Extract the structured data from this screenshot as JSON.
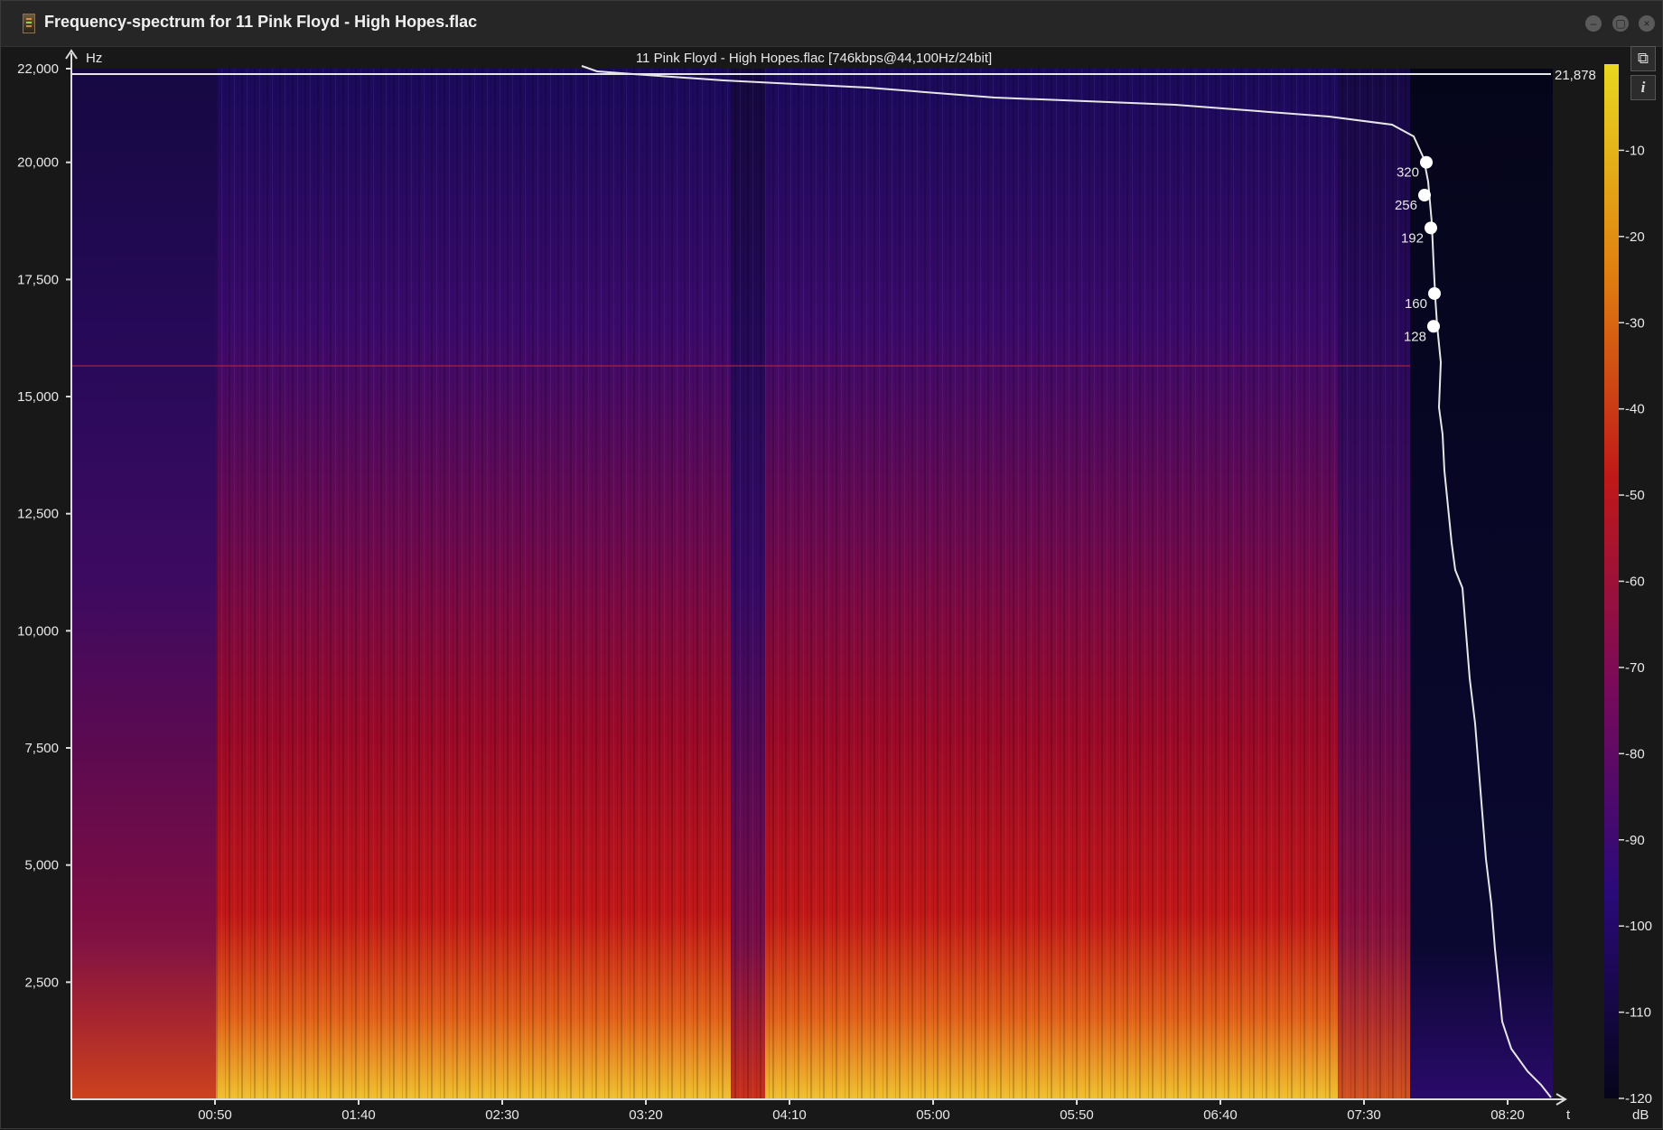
{
  "window": {
    "title": "Frequency-spectrum for 11 Pink Floyd - High Hopes.flac",
    "minimize_glyph": "–",
    "maximize_glyph": "▢",
    "close_glyph": "×"
  },
  "plot": {
    "file_info": "11 Pink Floyd - High Hopes.flac [746kbps@44,100Hz/24bit]",
    "y_unit": "Hz",
    "x_unit": "t",
    "y_ticks": [
      "22,000",
      "20,000",
      "17,500",
      "15,000",
      "12,500",
      "10,000",
      "7,500",
      "5,000",
      "2,500"
    ],
    "x_ticks": [
      "00:50",
      "01:40",
      "02:30",
      "03:20",
      "04:10",
      "05:00",
      "05:50",
      "06:40",
      "07:30",
      "08:20"
    ],
    "cutoff_label": "21,878",
    "bitrate_markers": [
      {
        "label": "320",
        "freq": 20000
      },
      {
        "label": "256",
        "freq": 19300
      },
      {
        "label": "192",
        "freq": 18600
      },
      {
        "label": "160",
        "freq": 17200
      },
      {
        "label": "128",
        "freq": 16500
      }
    ]
  },
  "colorbar": {
    "unit": "dB",
    "ticks": [
      "-10",
      "-20",
      "-30",
      "-40",
      "-50",
      "-60",
      "-70",
      "-80",
      "-90",
      "-100",
      "-110",
      "-120"
    ]
  },
  "colors": {
    "background": "#181818",
    "colormap_high": "#e8d820",
    "colormap_mid": "#c01818",
    "colormap_low": "#2a0a6a",
    "colormap_floor": "#05051a",
    "curve": "#e6e6e6"
  },
  "side_buttons": {
    "open_glyph": "⧉",
    "info_glyph": "i"
  }
}
